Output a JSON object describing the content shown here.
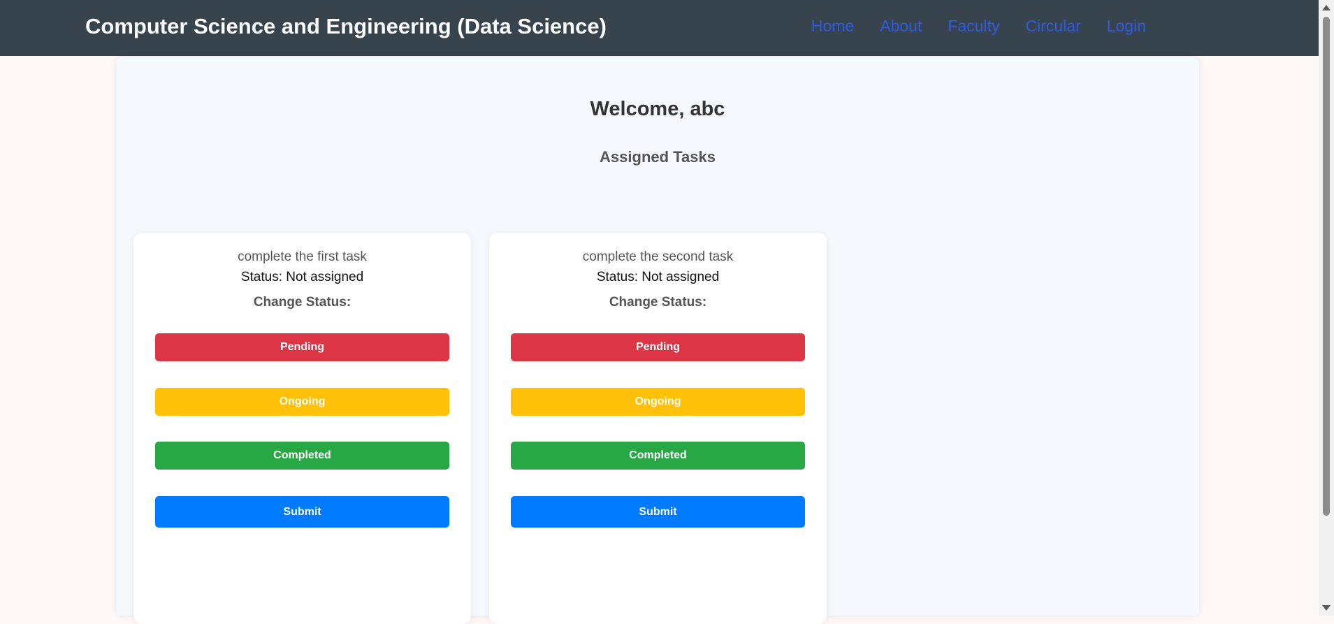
{
  "header": {
    "title": "Computer Science and Engineering (Data Science)",
    "nav": [
      {
        "label": "Home"
      },
      {
        "label": "About"
      },
      {
        "label": "Faculty"
      },
      {
        "label": "Circular"
      },
      {
        "label": "Login"
      }
    ]
  },
  "main": {
    "welcome": "Welcome, abc",
    "section_title": "Assigned Tasks",
    "tasks": [
      {
        "description": "complete the first task",
        "status": "Status: Not assigned",
        "change_label": "Change Status:",
        "buttons": {
          "pending": "Pending",
          "ongoing": "Ongoing",
          "completed": "Completed",
          "submit": "Submit"
        }
      },
      {
        "description": "complete the second task",
        "status": "Status: Not assigned",
        "change_label": "Change Status:",
        "buttons": {
          "pending": "Pending",
          "ongoing": "Ongoing",
          "completed": "Completed",
          "submit": "Submit"
        }
      }
    ]
  },
  "colors": {
    "navbar": "#37434d",
    "link": "#2f5be0",
    "pending": "#dc3545",
    "ongoing": "#ffc107",
    "completed": "#28a745",
    "submit": "#007bff"
  }
}
